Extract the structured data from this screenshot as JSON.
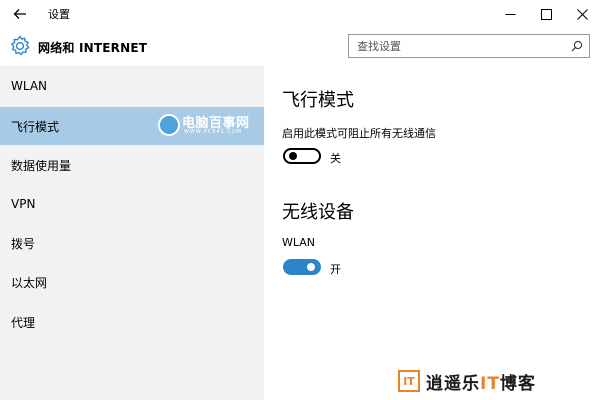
{
  "window": {
    "title": "设置"
  },
  "header": {
    "title": "网络和 INTERNET",
    "search_placeholder": "查找设置"
  },
  "sidebar": {
    "items": [
      {
        "label": "WLAN",
        "active": false
      },
      {
        "label": "飞行模式",
        "active": true
      },
      {
        "label": "数据使用量",
        "active": false
      },
      {
        "label": "VPN",
        "active": false
      },
      {
        "label": "拨号",
        "active": false
      },
      {
        "label": "以太网",
        "active": false
      },
      {
        "label": "代理",
        "active": false
      }
    ]
  },
  "airplane": {
    "title": "飞行模式",
    "description": "启用此模式可阻止所有无线通信",
    "state_label": "关",
    "on": false
  },
  "wireless": {
    "title": "无线设备",
    "wlan_label": "WLAN",
    "state_label": "开",
    "on": true
  },
  "watermarks": {
    "pc841_text": "电脑百事网",
    "pc841_sub": "WWW.PC841.COM",
    "blog_logo": "IT",
    "blog_text_a": "逍遥乐",
    "blog_text_it": "IT",
    "blog_text_b": "博客"
  },
  "colors": {
    "accent": "#2b86c9",
    "sidebar_bg": "#f2f2f2",
    "selected_bg": "#a7cbe6",
    "watermark_orange": "#e8832a"
  },
  "icons": {
    "back": "back-arrow-icon",
    "gear": "gear-icon",
    "search": "search-icon",
    "minimize": "minimize-icon",
    "maximize": "maximize-icon",
    "close": "close-icon"
  }
}
